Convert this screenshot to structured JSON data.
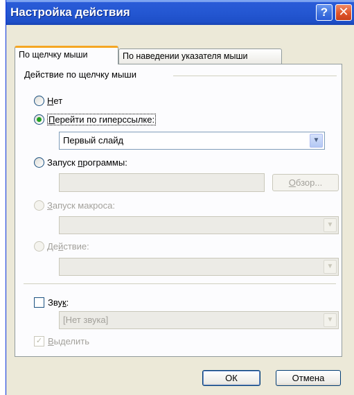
{
  "dialog_title": "Настройка действия",
  "tabs": [
    {
      "label": "По щелчку мыши",
      "active": true
    },
    {
      "label": "По наведении указателя мыши",
      "active": false
    }
  ],
  "group": {
    "legend": "Действие по щелчку мыши"
  },
  "options": {
    "none": {
      "label": "Нет",
      "accel": "Н",
      "rest": "ет",
      "checked": false,
      "enabled": true
    },
    "hyperlink": {
      "label": "Перейти по гиперссылке:",
      "accel": "П",
      "rest": "ерейти по гиперссылке:",
      "checked": true,
      "enabled": true,
      "value": "Первый слайд"
    },
    "program": {
      "label": "Запуск программы:",
      "pre": "Запуск ",
      "accel": "п",
      "rest": "рограммы:",
      "checked": false,
      "enabled": true,
      "value": "",
      "browse_label": "Обзор...",
      "browse_accel": "О",
      "browse_rest": "бзор..."
    },
    "macro": {
      "label": "Запуск макроса:",
      "accel": "З",
      "rest": "апуск макроса:",
      "checked": false,
      "enabled": false,
      "value": ""
    },
    "action": {
      "label": "Действие:",
      "pre": "Де",
      "accel": "й",
      "rest": "ствие:",
      "checked": false,
      "enabled": false,
      "value": ""
    }
  },
  "sound": {
    "label": "Звук:",
    "pre": "Зву",
    "accel": "к",
    "rest": ":",
    "checked": false,
    "value": "[Нет звука]"
  },
  "highlight": {
    "label": "Выделить",
    "accel": "В",
    "rest": "ыделить",
    "checked": true,
    "enabled": false
  },
  "buttons": {
    "ok": "ОК",
    "cancel": "Отмена"
  },
  "colors": {
    "titlebar": "#2a5bd7",
    "tab_highlight": "#f5a623",
    "close_button": "#e0552a",
    "help_button": "#3f73de",
    "dialog_bg": "#ece9d8"
  }
}
